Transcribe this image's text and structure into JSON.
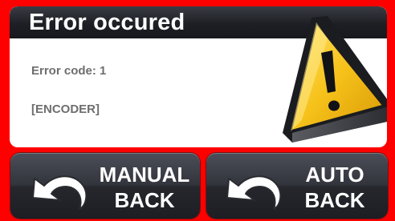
{
  "dialog": {
    "title": "Error occured",
    "error_code_line": "Error code: 1",
    "error_name": "[ENCODER]",
    "icon": "warning-triangle-icon"
  },
  "buttons": {
    "manual": {
      "line1": "MANUAL",
      "line2": "BACK",
      "icon": "back-arrow-icon"
    },
    "auto": {
      "line1": "AUTO",
      "line2": "BACK",
      "icon": "back-arrow-icon"
    }
  },
  "colors": {
    "frame": "#ff0000",
    "panel": "#ffffff",
    "title_bar": "#1e1f25",
    "button": "#33353d",
    "warning_yellow": "#f7c21a",
    "text_muted": "#6e6e6e"
  }
}
